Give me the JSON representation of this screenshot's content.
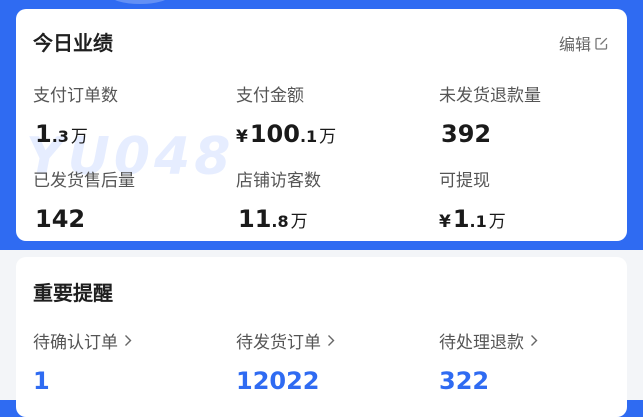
{
  "performance": {
    "title": "今日业绩",
    "edit_label": "编辑",
    "metrics": [
      {
        "label": "支付订单数",
        "currency": "",
        "int": "1",
        "dec": ".3",
        "unit": "万"
      },
      {
        "label": "支付金额",
        "currency": "¥",
        "int": "100",
        "dec": ".1",
        "unit": "万"
      },
      {
        "label": "未发货退款量",
        "currency": "",
        "int": "392",
        "dec": "",
        "unit": ""
      },
      {
        "label": "已发货售后量",
        "currency": "",
        "int": "142",
        "dec": "",
        "unit": ""
      },
      {
        "label": "店铺访客数",
        "currency": "",
        "int": "11",
        "dec": ".8",
        "unit": "万"
      },
      {
        "label": "可提现",
        "currency": "¥",
        "int": "1",
        "dec": ".1",
        "unit": "万"
      }
    ]
  },
  "reminders": {
    "title": "重要提醒",
    "items": [
      {
        "label": "待确认订单",
        "value": "1"
      },
      {
        "label": "待发货订单",
        "value": "12022"
      },
      {
        "label": "待处理退款",
        "value": "322"
      }
    ]
  },
  "watermark": "YU048",
  "colors": {
    "accent": "#2f6bf2",
    "card": "#ffffff",
    "page": "#f3f5f8"
  },
  "icons": {
    "edit": "edit-square-icon",
    "chevron": "chevron-right-icon"
  }
}
